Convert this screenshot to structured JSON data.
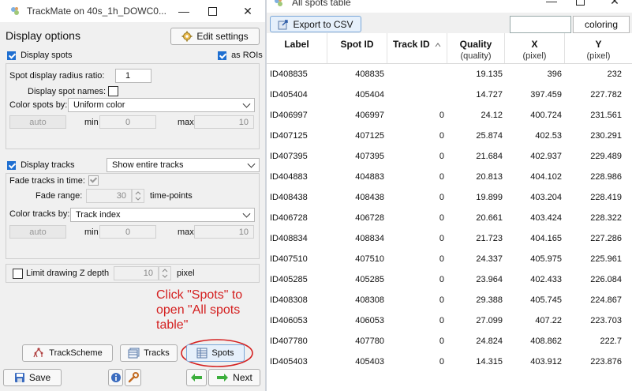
{
  "left_window": {
    "title": "TrackMate on 40s_1h_DOWC0...",
    "display_options_label": "Display options",
    "edit_settings_label": "Edit settings",
    "display_spots_label": "Display spots",
    "as_rois_label": "as ROIs",
    "spot_radius_label": "Spot display radius ratio:",
    "spot_radius_value": "1",
    "display_spot_names_label": "Display spot names:",
    "color_spots_by_label": "Color spots by:",
    "color_spots_by_value": "Uniform color",
    "spots_auto_label": "auto",
    "spots_min_label": "min",
    "spots_min_value": "0",
    "spots_max_label": "max",
    "spots_max_value": "10",
    "display_tracks_label": "Display tracks",
    "track_display_mode": "Show entire tracks",
    "fade_tracks_label": "Fade tracks in time:",
    "fade_range_label": "Fade range:",
    "fade_range_value": "30",
    "fade_range_unit": "time-points",
    "color_tracks_by_label": "Color tracks by:",
    "color_tracks_by_value": "Track index",
    "tracks_auto_label": "auto",
    "tracks_min_label": "min",
    "tracks_min_value": "0",
    "tracks_max_label": "max",
    "tracks_max_value": "10",
    "limit_z_label": "Limit drawing Z depth",
    "limit_z_value": "10",
    "limit_z_unit": "pixel",
    "annotation": "Click \"Spots\" to open \"All spots table\"",
    "trackscheme_label": "TrackScheme",
    "tracks_label": "Tracks",
    "spots_label": "Spots",
    "save_label": "Save",
    "next_label": "Next"
  },
  "right_window": {
    "title": "All spots table",
    "export_label": "Export to CSV",
    "search_value": "",
    "coloring_label": "coloring",
    "columns": [
      {
        "name": "Label",
        "unit": ""
      },
      {
        "name": "Spot ID",
        "unit": ""
      },
      {
        "name": "Track ID",
        "unit": ""
      },
      {
        "name": "Quality",
        "unit": "(quality)"
      },
      {
        "name": "X",
        "unit": "(pixel)"
      },
      {
        "name": "Y",
        "unit": "(pixel)"
      }
    ],
    "rows": [
      [
        "ID408835",
        "408835",
        "",
        "19.135",
        "396",
        "232"
      ],
      [
        "ID405404",
        "405404",
        "",
        "14.727",
        "397.459",
        "227.782"
      ],
      [
        "ID406997",
        "406997",
        "0",
        "24.12",
        "400.724",
        "231.561"
      ],
      [
        "ID407125",
        "407125",
        "0",
        "25.874",
        "402.53",
        "230.291"
      ],
      [
        "ID407395",
        "407395",
        "0",
        "21.684",
        "402.937",
        "229.489"
      ],
      [
        "ID404883",
        "404883",
        "0",
        "20.813",
        "404.102",
        "228.986"
      ],
      [
        "ID408438",
        "408438",
        "0",
        "19.899",
        "403.204",
        "228.419"
      ],
      [
        "ID406728",
        "406728",
        "0",
        "20.661",
        "403.424",
        "228.322"
      ],
      [
        "ID408834",
        "408834",
        "0",
        "21.723",
        "404.165",
        "227.286"
      ],
      [
        "ID407510",
        "407510",
        "0",
        "24.337",
        "405.975",
        "225.961"
      ],
      [
        "ID405285",
        "405285",
        "0",
        "23.964",
        "402.433",
        "226.084"
      ],
      [
        "ID408308",
        "408308",
        "0",
        "29.388",
        "405.745",
        "224.867"
      ],
      [
        "ID406053",
        "406053",
        "0",
        "27.099",
        "407.22",
        "223.703"
      ],
      [
        "ID407780",
        "407780",
        "0",
        "24.824",
        "408.862",
        "222.7"
      ],
      [
        "ID405403",
        "405403",
        "0",
        "14.315",
        "403.912",
        "223.876"
      ]
    ]
  }
}
